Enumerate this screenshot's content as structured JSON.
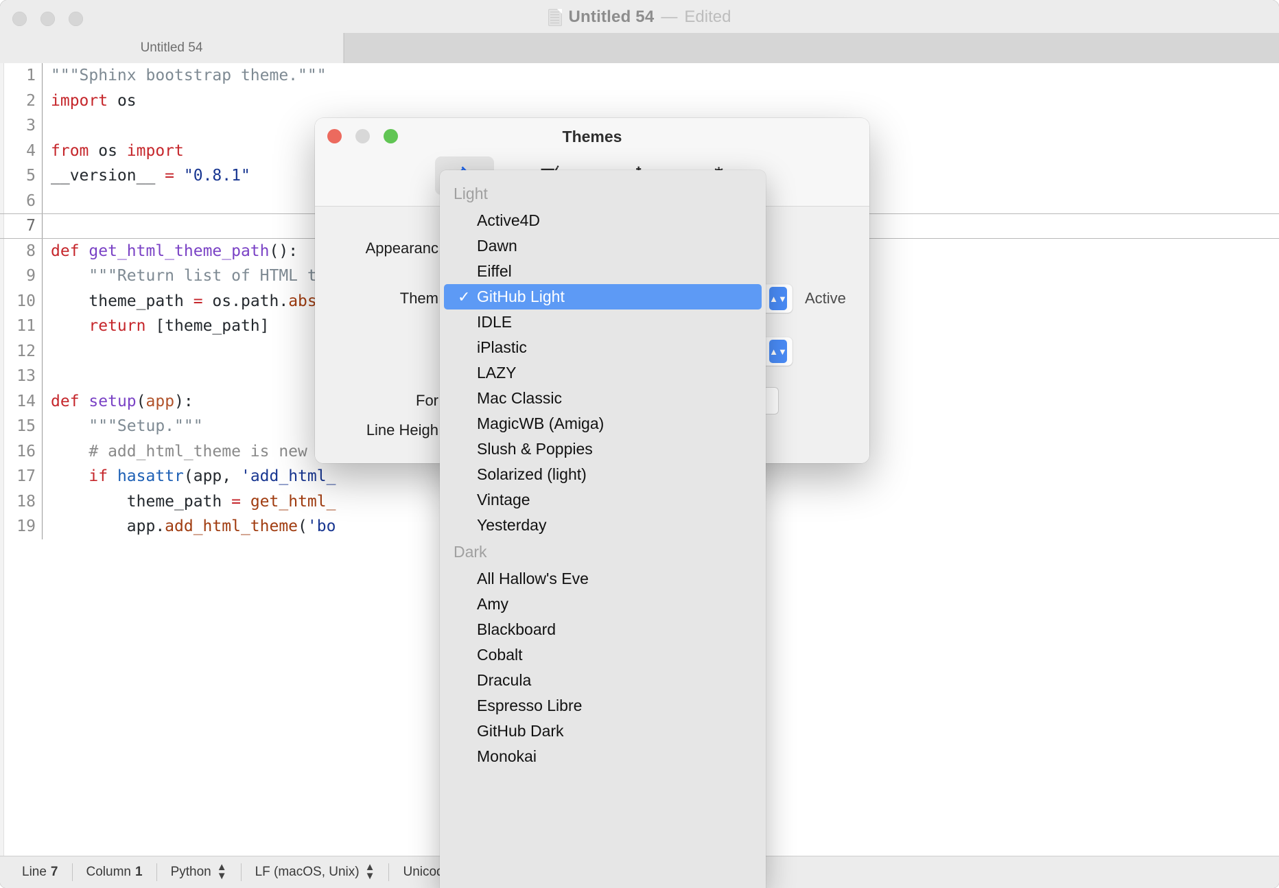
{
  "editor": {
    "window_title": "Untitled 54",
    "window_title_dash": "—",
    "window_title_state": "Edited",
    "tab_label": "Untitled 54",
    "code_lines": [
      {
        "n": "1",
        "tokens": [
          {
            "t": "\"\"\"Sphinx bootstrap theme.\"\"\"",
            "c": "s"
          }
        ]
      },
      {
        "n": "2",
        "tokens": [
          {
            "t": "import",
            "c": "k"
          },
          {
            "t": " os",
            "c": "code-text"
          }
        ]
      },
      {
        "n": "3",
        "tokens": []
      },
      {
        "n": "4",
        "tokens": [
          {
            "t": "from",
            "c": "k"
          },
          {
            "t": " os ",
            "c": "code-text"
          },
          {
            "t": "import",
            "c": "k"
          }
        ]
      },
      {
        "n": "5",
        "tokens": [
          {
            "t": "__version__ ",
            "c": "code-text"
          },
          {
            "t": "=",
            "c": "op"
          },
          {
            "t": " ",
            "c": "code-text"
          },
          {
            "t": "\"0.8.1\"",
            "c": "num"
          }
        ]
      },
      {
        "n": "6",
        "tokens": []
      },
      {
        "n": "7",
        "tokens": [],
        "current": true
      },
      {
        "n": "8",
        "tokens": [
          {
            "t": "def",
            "c": "k"
          },
          {
            "t": " ",
            "c": "code-text"
          },
          {
            "t": "get_html_theme_path",
            "c": "fn"
          },
          {
            "t": "():",
            "c": "code-text"
          }
        ]
      },
      {
        "n": "9",
        "tokens": [
          {
            "t": "    \"\"\"Return list of HTML the",
            "c": "s"
          }
        ]
      },
      {
        "n": "10",
        "tokens": [
          {
            "t": "    theme_path ",
            "c": "code-text"
          },
          {
            "t": "=",
            "c": "op"
          },
          {
            "t": " os.path.",
            "c": "code-text"
          },
          {
            "t": "abspa",
            "c": "call"
          }
        ]
      },
      {
        "n": "11",
        "tokens": [
          {
            "t": "    ",
            "c": "code-text"
          },
          {
            "t": "return",
            "c": "k"
          },
          {
            "t": " [theme_path]",
            "c": "code-text"
          }
        ]
      },
      {
        "n": "12",
        "tokens": []
      },
      {
        "n": "13",
        "tokens": []
      },
      {
        "n": "14",
        "tokens": [
          {
            "t": "def",
            "c": "k"
          },
          {
            "t": " ",
            "c": "code-text"
          },
          {
            "t": "setup",
            "c": "fn"
          },
          {
            "t": "(",
            "c": "code-text"
          },
          {
            "t": "app",
            "c": "par"
          },
          {
            "t": "):",
            "c": "code-text"
          }
        ]
      },
      {
        "n": "15",
        "tokens": [
          {
            "t": "    \"\"\"Setup.\"\"\"",
            "c": "s"
          }
        ]
      },
      {
        "n": "16",
        "tokens": [
          {
            "t": "    # add_html_theme is new i",
            "c": "cm"
          }
        ]
      },
      {
        "n": "17",
        "tokens": [
          {
            "t": "    ",
            "c": "code-text"
          },
          {
            "t": "if",
            "c": "k"
          },
          {
            "t": " ",
            "c": "code-text"
          },
          {
            "t": "hasattr",
            "c": "bi"
          },
          {
            "t": "(app, ",
            "c": "code-text"
          },
          {
            "t": "'add_html_",
            "c": "str"
          }
        ]
      },
      {
        "n": "18",
        "tokens": [
          {
            "t": "        theme_path ",
            "c": "code-text"
          },
          {
            "t": "=",
            "c": "op"
          },
          {
            "t": " ",
            "c": "code-text"
          },
          {
            "t": "get_html_",
            "c": "call"
          }
        ]
      },
      {
        "n": "19",
        "tokens": [
          {
            "t": "        app.",
            "c": "code-text"
          },
          {
            "t": "add_html_theme",
            "c": "call"
          },
          {
            "t": "(",
            "c": "code-text"
          },
          {
            "t": "'bo",
            "c": "str"
          }
        ]
      }
    ],
    "status_bar": {
      "line_label": "Line",
      "line_value": "7",
      "column_label": "Column",
      "column_value": "1",
      "language": "Python",
      "line_ending": "LF (macOS, Unix)",
      "encoding": "Unicode (UT"
    }
  },
  "themes_window": {
    "title": "Themes",
    "toolbar": [
      {
        "name": "appearance",
        "icon": "paint-bucket-icon",
        "active": true
      },
      {
        "name": "editing",
        "icon": "edit-pencil-icon",
        "active": false
      },
      {
        "name": "assistant",
        "icon": "sparkle-wand-icon",
        "active": false
      },
      {
        "name": "advanced",
        "icon": "gear-icon",
        "active": false
      }
    ],
    "rows": {
      "appearance_label": "Appearanc",
      "theme_label": "Them",
      "theme_value": "",
      "theme_status": "Active",
      "font_label": "For",
      "line_height_label": "Line Heigh"
    }
  },
  "theme_menu": {
    "sections": [
      {
        "title": "Light",
        "items": [
          {
            "label": "Active4D",
            "selected": false
          },
          {
            "label": "Dawn",
            "selected": false
          },
          {
            "label": "Eiffel",
            "selected": false
          },
          {
            "label": "GitHub Light",
            "selected": true
          },
          {
            "label": "IDLE",
            "selected": false
          },
          {
            "label": "iPlastic",
            "selected": false
          },
          {
            "label": "LAZY",
            "selected": false
          },
          {
            "label": "Mac Classic",
            "selected": false
          },
          {
            "label": "MagicWB (Amiga)",
            "selected": false
          },
          {
            "label": "Slush & Poppies",
            "selected": false
          },
          {
            "label": "Solarized (light)",
            "selected": false
          },
          {
            "label": "Vintage",
            "selected": false
          },
          {
            "label": "Yesterday",
            "selected": false
          }
        ]
      },
      {
        "title": "Dark",
        "items": [
          {
            "label": "All Hallow's Eve",
            "selected": false
          },
          {
            "label": "Amy",
            "selected": false
          },
          {
            "label": "Blackboard",
            "selected": false
          },
          {
            "label": "Cobalt",
            "selected": false
          },
          {
            "label": "Dracula",
            "selected": false
          },
          {
            "label": "Espresso Libre",
            "selected": false
          },
          {
            "label": "GitHub Dark",
            "selected": false
          },
          {
            "label": "Monokai",
            "selected": false
          }
        ]
      }
    ],
    "checkmark": "✓",
    "highlight_color": "#5d9af5"
  }
}
